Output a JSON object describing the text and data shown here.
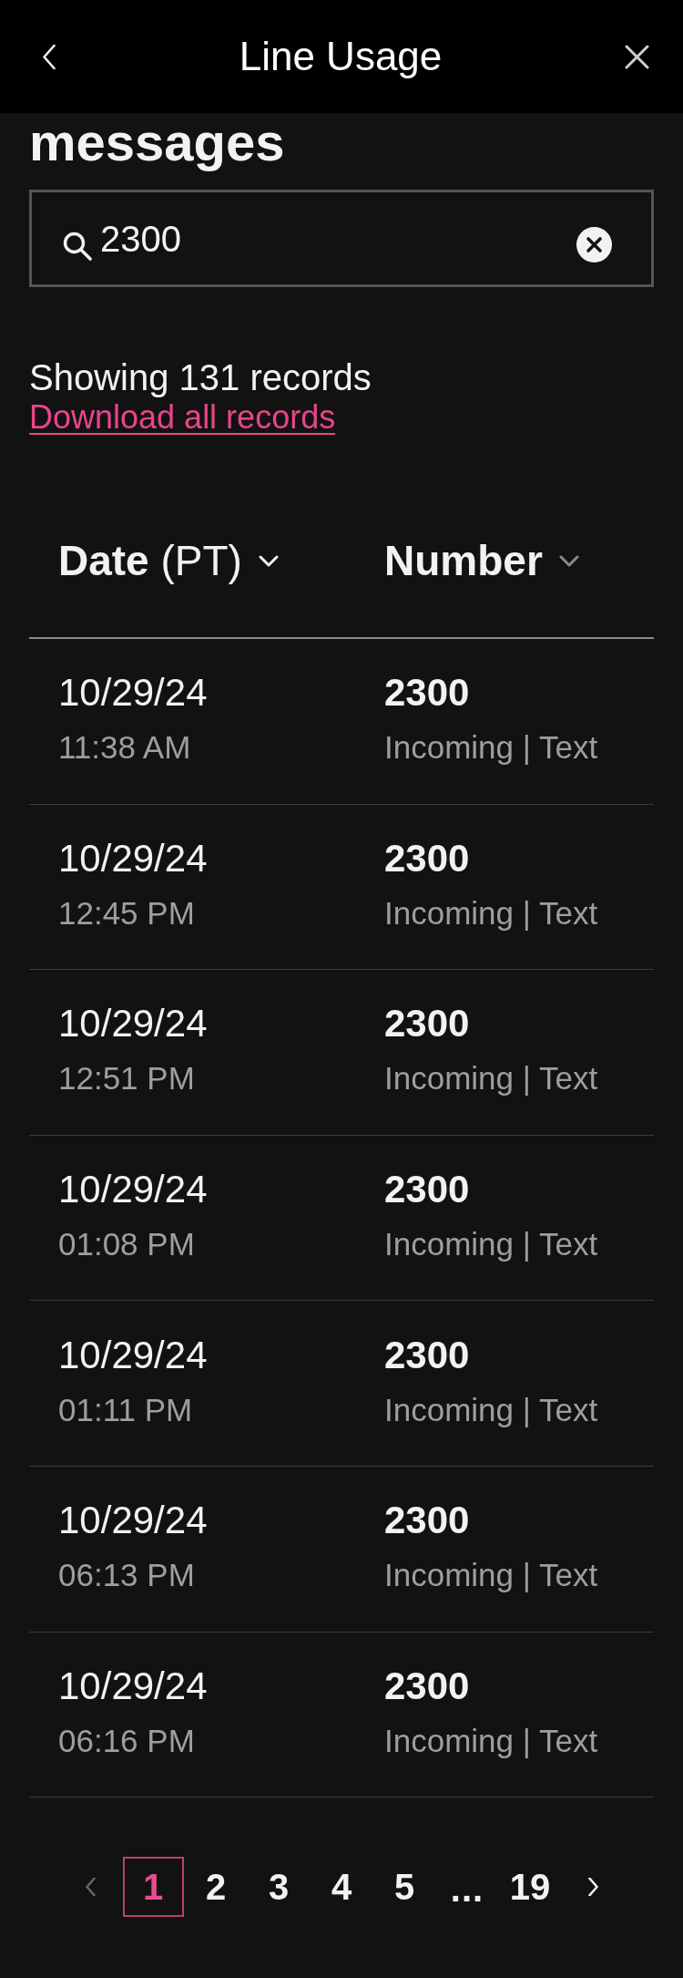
{
  "header": {
    "title": "Line Usage"
  },
  "heading": "messages",
  "search": {
    "value": "2300"
  },
  "summary": {
    "text": "Showing 131 records",
    "link": "Download all records"
  },
  "table": {
    "columns": [
      {
        "label": "Date",
        "unit": "(PT)",
        "sorted": true
      },
      {
        "label": "Number",
        "sorted": false
      }
    ],
    "rows": [
      {
        "date": "10/29/24",
        "time": "11:38 AM",
        "number": "2300",
        "detail": "Incoming | Text"
      },
      {
        "date": "10/29/24",
        "time": "12:45 PM",
        "number": "2300",
        "detail": "Incoming | Text"
      },
      {
        "date": "10/29/24",
        "time": "12:51 PM",
        "number": "2300",
        "detail": "Incoming | Text"
      },
      {
        "date": "10/29/24",
        "time": "01:08 PM",
        "number": "2300",
        "detail": "Incoming | Text"
      },
      {
        "date": "10/29/24",
        "time": "01:11 PM",
        "number": "2300",
        "detail": "Incoming | Text"
      },
      {
        "date": "10/29/24",
        "time": "06:13 PM",
        "number": "2300",
        "detail": "Incoming | Text"
      },
      {
        "date": "10/29/24",
        "time": "06:16 PM",
        "number": "2300",
        "detail": "Incoming | Text"
      }
    ]
  },
  "pagination": {
    "prev": {
      "disabled": true
    },
    "pages": [
      {
        "kind": "page",
        "label": "1",
        "selected": true
      },
      {
        "kind": "page",
        "label": "2",
        "selected": false
      },
      {
        "kind": "page",
        "label": "3",
        "selected": false
      },
      {
        "kind": "page",
        "label": "4",
        "selected": false
      },
      {
        "kind": "page",
        "label": "5",
        "selected": false
      },
      {
        "kind": "ellipsis",
        "label": "...",
        "selected": false
      },
      {
        "kind": "page",
        "label": "19",
        "selected": false
      }
    ],
    "next": {
      "disabled": false
    }
  }
}
